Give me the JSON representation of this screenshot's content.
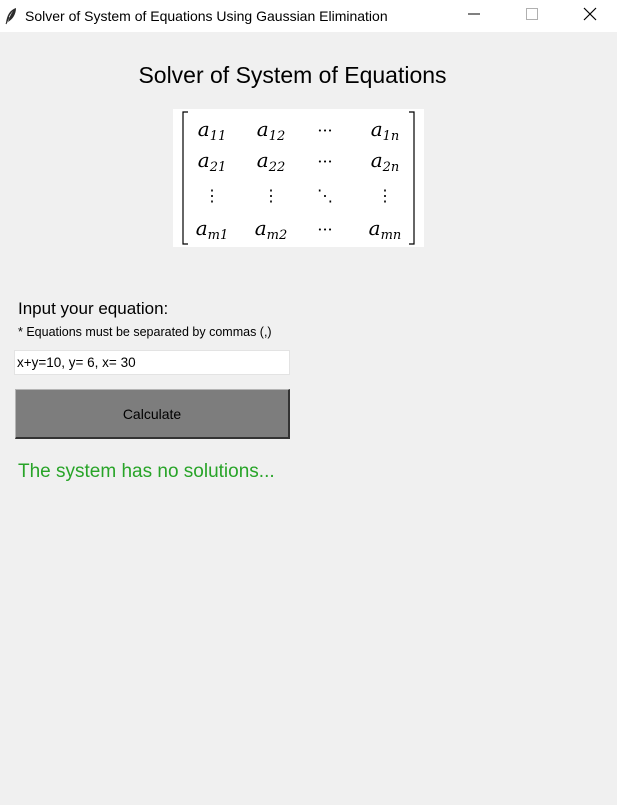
{
  "window": {
    "title": "Solver of System of Equations Using Gaussian Elimination",
    "minimize_icon": "minimize-icon",
    "maximize_icon": "maximize-icon",
    "close_icon": "close-icon"
  },
  "main": {
    "heading": "Solver of System of Equations",
    "matrix_image": {
      "cells": [
        [
          "a11",
          "a12",
          "···",
          "a1n"
        ],
        [
          "a21",
          "a22",
          "···",
          "a2n"
        ],
        [
          "⋮",
          "⋮",
          "⋱",
          "⋮"
        ],
        [
          "am1",
          "am2",
          "···",
          "amn"
        ]
      ]
    },
    "input_label": "Input your equation:",
    "input_note": "* Equations must be separated by commas (,)",
    "equation_value": "x+y=10, y= 6, x= 30",
    "calculate_label": "Calculate",
    "result_text": "The system has no solutions...",
    "result_color": "#28a428"
  }
}
